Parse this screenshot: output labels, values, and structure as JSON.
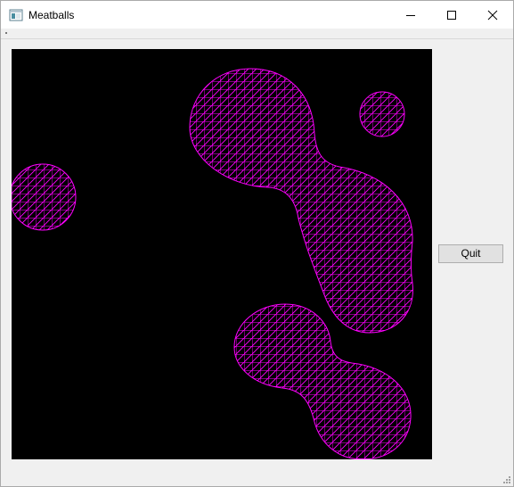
{
  "window": {
    "title": "Meatballs",
    "controls": {
      "minimize_icon": "minimize-icon",
      "maximize_icon": "maximize-icon",
      "close_icon": "close-icon"
    }
  },
  "canvas": {
    "background": "#000000",
    "mesh_color": "#ff00ff"
  },
  "buttons": {
    "quit_label": "Quit"
  },
  "colors": {
    "window_bg": "#f0f0f0",
    "titlebar_bg": "#ffffff",
    "button_bg": "#e1e1e1",
    "button_border": "#adadad"
  }
}
